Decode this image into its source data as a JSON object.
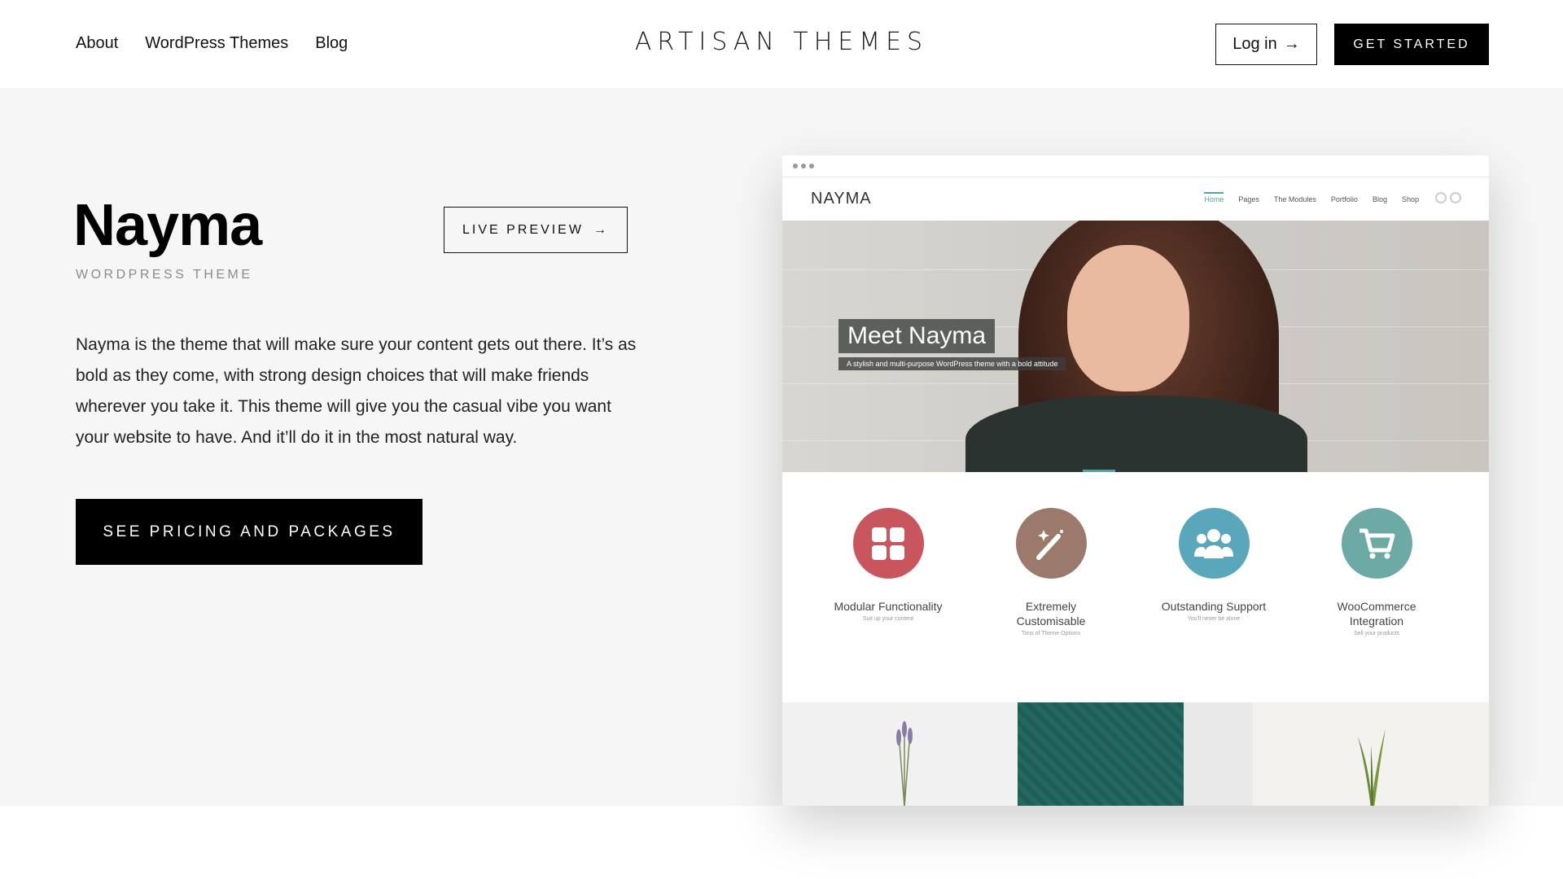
{
  "header": {
    "nav": [
      "About",
      "WordPress Themes",
      "Blog"
    ],
    "logo": "ARTISAN THEMES",
    "login_label": "Log in",
    "login_arrow": "→",
    "cta_label": "GET STARTED"
  },
  "hero": {
    "title": "Nayma",
    "subtitle": "WORDPRESS THEME",
    "live_preview_label": "LIVE PREVIEW",
    "live_preview_arrow": "→",
    "description": "Nayma is the theme that will make sure your content gets out there. It’s as bold as they come, with strong design choices that will make friends wherever you take it. This theme will give you the casual vibe you want your website to have. And it’ll do it in the most natural way.",
    "pricing_label": "SEE PRICING AND PACKAGES"
  },
  "preview": {
    "brand": "NAYMA",
    "menu": [
      "Home",
      "Pages",
      "The Modules",
      "Portfolio",
      "Blog",
      "Shop"
    ],
    "headline": "Meet Nayma",
    "tagline": "A stylish and multi-purpose WordPress theme with a bold attitude",
    "features": [
      {
        "title": "Modular Functionality",
        "sub": "Suit up your content",
        "color": "#c9555e",
        "icon": "grid-icon"
      },
      {
        "title": "Extremely Customisable",
        "sub": "Tons of Theme Options",
        "color": "#9b7a6b",
        "icon": "magic-wand-icon"
      },
      {
        "title": "Outstanding Support",
        "sub": "You'll never be alone",
        "color": "#5aa7bb",
        "icon": "users-icon"
      },
      {
        "title": "WooCommerce Integration",
        "sub": "Sell your products",
        "color": "#6eaaa5",
        "icon": "cart-icon"
      }
    ]
  }
}
